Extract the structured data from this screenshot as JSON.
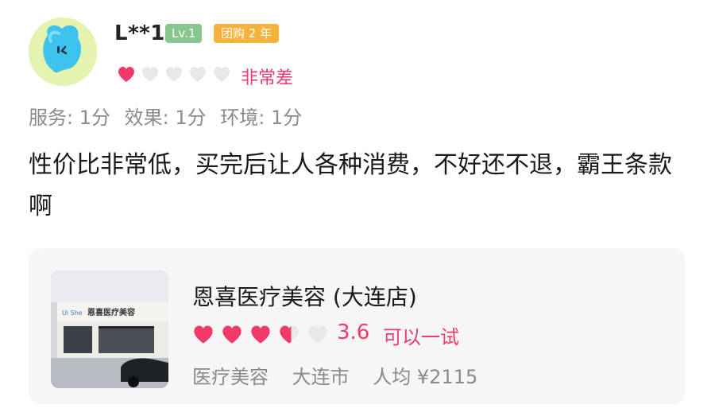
{
  "user": {
    "name": "L**1",
    "level_badge": "Lv.1",
    "group_badge": "团购 2 年",
    "rating_word": "非常差",
    "hearts": [
      1,
      0,
      0,
      0,
      0
    ]
  },
  "scores": [
    {
      "label": "服务: 1分"
    },
    {
      "label": "效果: 1分"
    },
    {
      "label": "环境: 1分"
    }
  ],
  "review_text": "性价比非常低，买完后让人各种消费，不好还不退，霸王条款啊",
  "shop": {
    "name": "恩喜医疗美容 (大连店)",
    "rating": "3.6",
    "rating_hearts": [
      1,
      1,
      1,
      0.6,
      0
    ],
    "verdict": "可以一试",
    "category": "医疗美容",
    "city": "大连市",
    "avg_price": "人均 ¥2115",
    "sign_brand": "Ui She",
    "sign_text": "恩喜医疗美容"
  },
  "colors": {
    "accent": "#ef3a6a",
    "heart_empty": "#e8e8e8",
    "badge_level": "#86c68f",
    "badge_group": "#f6b33c"
  }
}
